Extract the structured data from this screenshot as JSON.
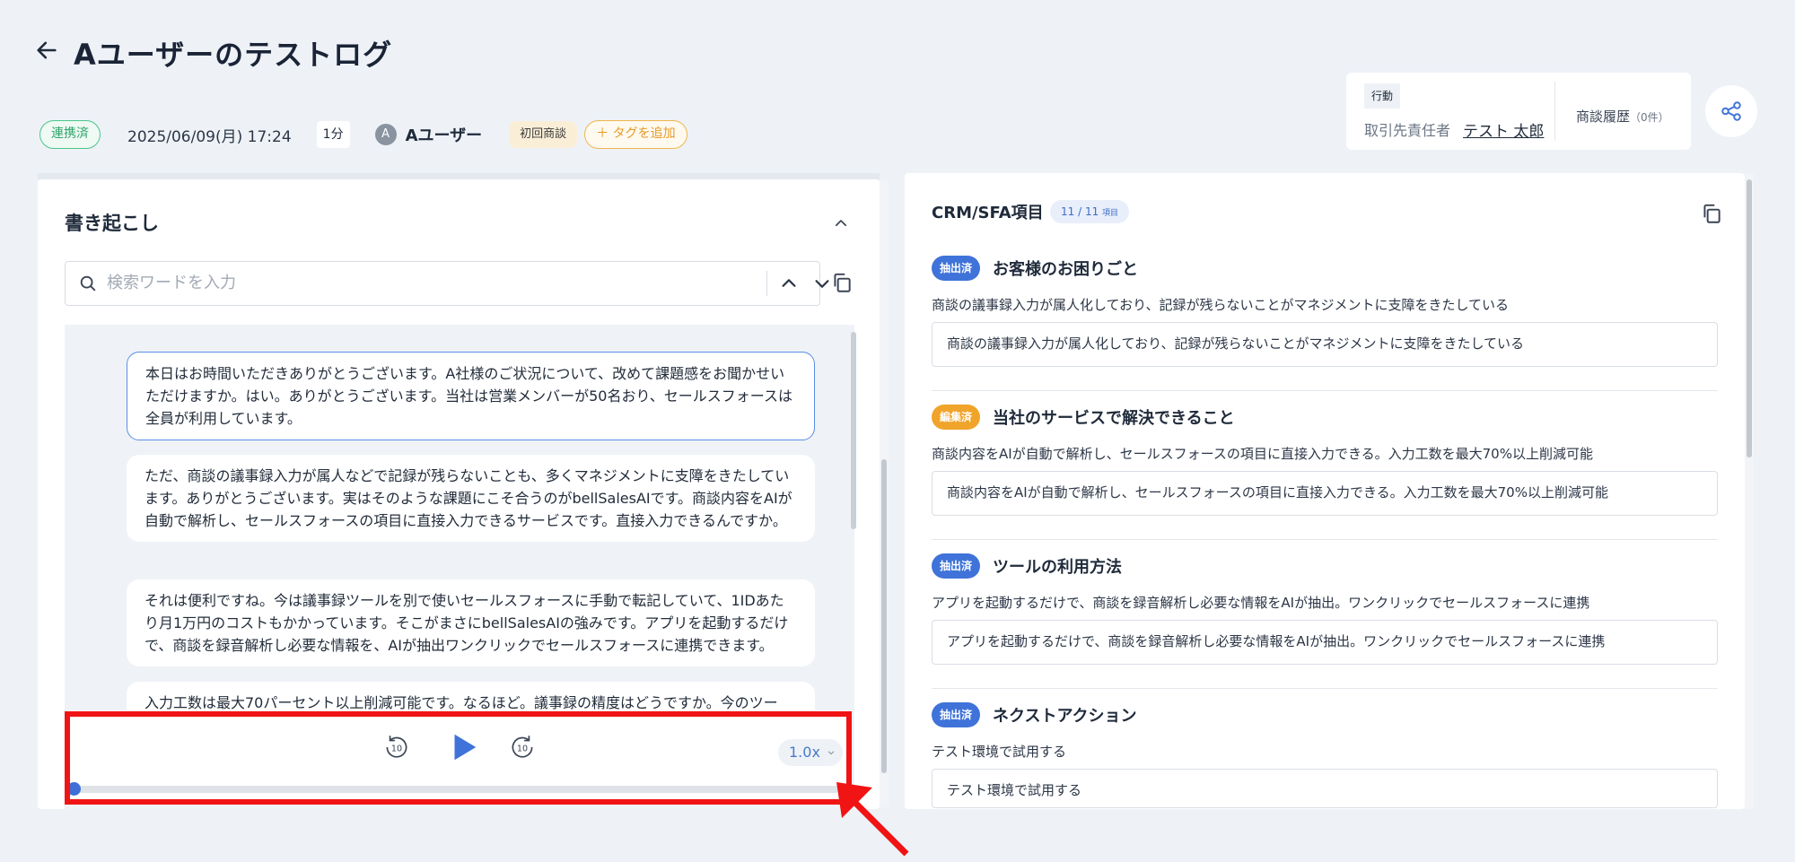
{
  "header": {
    "title": "Aユーザーのテストログ",
    "status_badge": "連携済",
    "date": "2025/06/09(月) 17:24",
    "duration": "1分",
    "user_initial": "A",
    "user_name": "Aユーザー",
    "tag": "初回商談",
    "add_tag_label": "＋ タグを追加"
  },
  "info_card": {
    "action_label": "行動",
    "contact_label": "取引先責任者",
    "contact_name": "テスト 太郎",
    "history_label": "商談履歴",
    "history_count": "（0件）"
  },
  "transcript": {
    "title": "書き起こし",
    "search_placeholder": "検索ワードを入力",
    "messages": [
      "本日はお時間いただきありがとうございます。A社様のご状況について、改めて課題感をお聞かせいただけますか。はい。ありがとうございます。当社は営業メンバーが50名おり、セールスフォースは全員が利用しています。",
      "ただ、商談の議事録入力が属人などで記録が残らないことも、多くマネジメントに支障をきたしています。ありがとうございます。実はそのような課題にこそ合うのがbellSalesAIです。商談内容をAIが自動で解析し、セールスフォースの項目に直接入力できるサービスです。直接入力できるんですか。",
      "それは便利ですね。今は議事録ツールを別で使いセールスフォースに手動で転記していて、1IDあたり月1万円のコストもかかっています。そこがまさにbellSalesAIの強みです。アプリを起動するだけで、商談を録音解析し必要な情報を、AIが抽出ワンクリックでセールスフォースに連携できます。",
      "入力工数は最大70パーセント以上削減可能です。なるほど。議事録の精度はどうですか。今のツー"
    ]
  },
  "player": {
    "speed": "1.0x",
    "progress": 0
  },
  "crm": {
    "title": "CRM/SFA項目",
    "count": "11 / 11",
    "count_unit": "項目",
    "sections": [
      {
        "status": "抽出済",
        "title": "お客様のお困りごと",
        "text": "商談の議事録入力が属人化しており、記録が残らないことがマネジメントに支障をきたしている",
        "value": "商談の議事録入力が属人化しており、記録が残らないことがマネジメントに支障をきたしている"
      },
      {
        "status": "編集済",
        "title": "当社のサービスで解決できること",
        "text": "商談内容をAIが自動で解析し、セールスフォースの項目に直接入力できる。入力工数を最大70%以上削減可能",
        "value": "商談内容をAIが自動で解析し、セールスフォースの項目に直接入力できる。入力工数を最大70%以上削減可能"
      },
      {
        "status": "抽出済",
        "title": "ツールの利用方法",
        "text": "アプリを起動するだけで、商談を録音解析し必要な情報をAIが抽出。ワンクリックでセールスフォースに連携",
        "value": "アプリを起動するだけで、商談を録音解析し必要な情報をAIが抽出。ワンクリックでセールスフォースに連携"
      },
      {
        "status": "抽出済",
        "title": "ネクストアクション",
        "text": "テスト環境で試用する",
        "value": "テスト環境で試用する"
      }
    ]
  },
  "colors": {
    "accent_blue": "#3f73d9",
    "edited_orange": "#f0a42a",
    "linked_green": "#2fa56c",
    "highlight_red": "#f01414"
  }
}
